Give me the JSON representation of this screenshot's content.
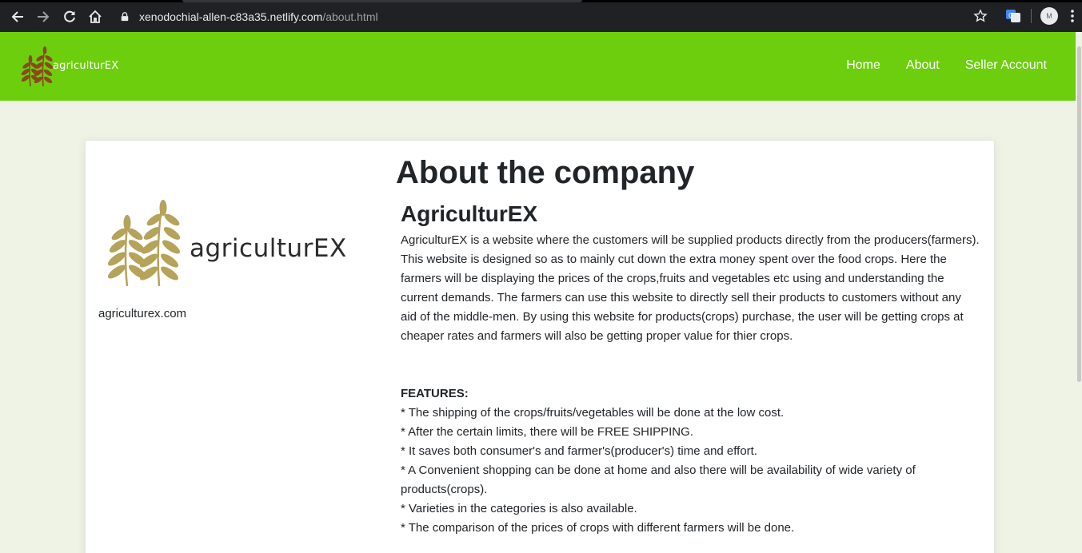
{
  "browser": {
    "url_host": "xenodochial-allen-c83a35.netlify.com",
    "url_path": "/about.html",
    "profile_initial": "M"
  },
  "navbar": {
    "brand": "agriculturEX",
    "links": [
      "Home",
      "About",
      "Seller Account"
    ],
    "bg_color": "#6dce0e"
  },
  "main": {
    "page_title": "About the company",
    "company_name": "AgriculturEX",
    "description": "AgriculturEX is a website where the customers will be supplied products directly from the producers(farmers). This website is designed so as to mainly cut down the extra money spent over the food crops. Here the farmers will be displaying the prices of the crops,fruits and vegetables etc using and understanding the current demands. The farmers can use this website to directly sell their products to customers without any aid of the middle-men. By using this website for products(crops) purchase, the user will be getting crops at cheaper rates and farmers will also be getting proper value for thier crops.",
    "logo_text": "agriculturEX",
    "site_link": "agriculturex.com",
    "features_heading": "FEATURES:",
    "features": [
      "* The shipping of the crops/fruits/vegetables will be done at the low cost.",
      "* After the certain limits, there will be FREE SHIPPING.",
      "* It saves both consumer's and farmer's(producer's) time and effort.",
      "* A Convenient shopping can be done at home and also there will be availability of wide variety of products(crops).",
      "* Varieties in the categories is also available.",
      "* The comparison of the prices of crops with different farmers will be done."
    ]
  },
  "icons": {
    "back": "arrow-left-icon",
    "forward": "arrow-right-icon",
    "reload": "reload-icon",
    "home": "home-icon",
    "lock": "lock-icon",
    "star": "star-icon",
    "translate": "translate-icon",
    "menu": "kebab-menu-icon"
  }
}
